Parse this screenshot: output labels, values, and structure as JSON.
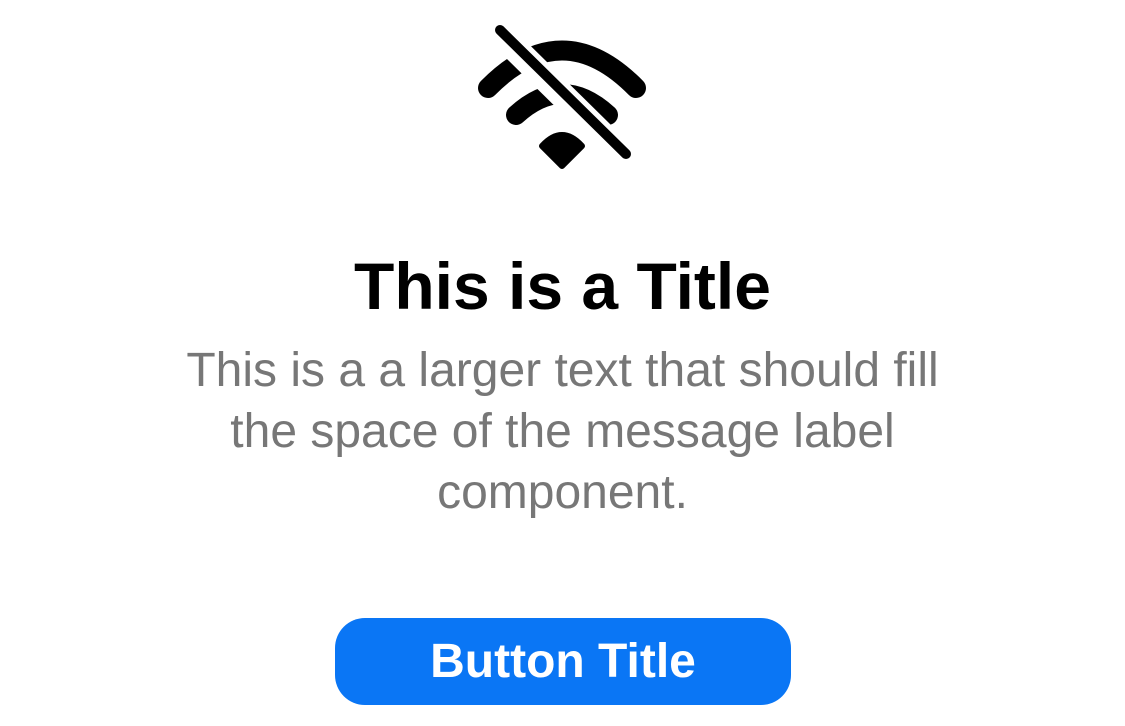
{
  "icon": {
    "name": "wifi-slash-icon"
  },
  "title": "This is a Title",
  "message": "This is a a larger text that should fill the space of the message label component.",
  "button": {
    "label": "Button Title"
  },
  "colors": {
    "accent": "#0a76f5",
    "title": "#000000",
    "message": "#777777",
    "background": "#ffffff"
  }
}
